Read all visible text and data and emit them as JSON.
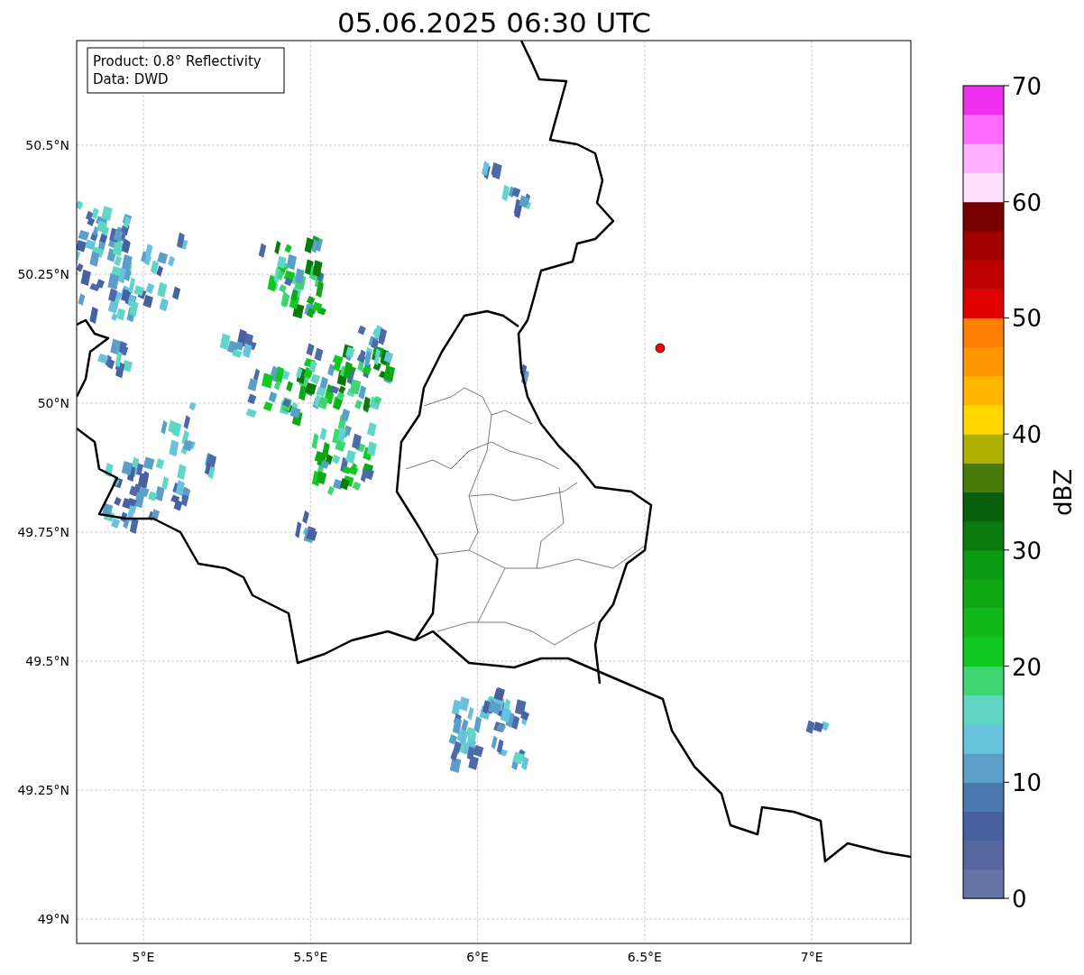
{
  "title": "05.06.2025 06:30 UTC",
  "info_box": {
    "lines": [
      "Product: 0.8° Reflectivity",
      "Data: DWD"
    ]
  },
  "map": {
    "x_tick_labels": [
      "5°E",
      "5.5°E",
      "6°E",
      "6.5°E",
      "7°E"
    ],
    "y_tick_labels": [
      "50.5°N",
      "50.25°N",
      "50°N",
      "49.75°N",
      "49.5°N",
      "49.25°N",
      "49°N"
    ]
  },
  "colorbar": {
    "label": "dBZ",
    "tick_labels": [
      "70",
      "60",
      "50",
      "40",
      "30",
      "20",
      "10",
      "0"
    ],
    "segments": [
      {
        "color": "#6674a8"
      },
      {
        "color": "#55669e"
      },
      {
        "color": "#4760a0"
      },
      {
        "color": "#4c7ab0"
      },
      {
        "color": "#5b9fc8"
      },
      {
        "color": "#66c2dd"
      },
      {
        "color": "#62d6c6"
      },
      {
        "color": "#3dd672"
      },
      {
        "color": "#10c820"
      },
      {
        "color": "#10b818"
      },
      {
        "color": "#0ea814"
      },
      {
        "color": "#0c9a12"
      },
      {
        "color": "#0a7a0e"
      },
      {
        "color": "#075f0a"
      },
      {
        "color": "#4a7a0a"
      },
      {
        "color": "#b0b000"
      },
      {
        "color": "#ffd800"
      },
      {
        "color": "#ffb800"
      },
      {
        "color": "#ff9800"
      },
      {
        "color": "#ff7f00"
      },
      {
        "color": "#e00000"
      },
      {
        "color": "#c00000"
      },
      {
        "color": "#a00000"
      },
      {
        "color": "#780000"
      },
      {
        "color": "#ffe0ff"
      },
      {
        "color": "#ffb0ff"
      },
      {
        "color": "#ff6cff"
      },
      {
        "color": "#f030f0"
      }
    ]
  }
}
